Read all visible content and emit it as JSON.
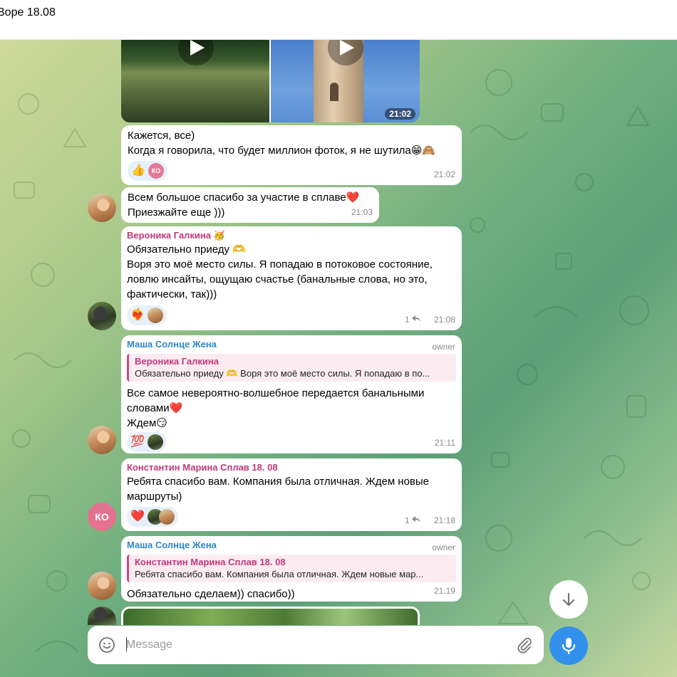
{
  "header": {
    "title": "Воре 18.08"
  },
  "media_album": {
    "time": "21:02"
  },
  "messages": [
    {
      "lines": [
        "Кажется, все)",
        "Когда я говорила, что будет миллион фоток, я не шутила😁🙈"
      ],
      "reactions": [
        "👍",
        "КО"
      ],
      "time": "21:02"
    },
    {
      "lines": [
        "Всем большое спасибо за участие в сплаве❤️",
        "Приезжайте еще )))"
      ],
      "time": "21:03"
    },
    {
      "sender": "Вероника Галкина 🥳",
      "lines": [
        "Обязательно приеду 🫶",
        "Воря это моё место силы. Я попадаю в потоковое состояние,",
        "ловлю инсайты, ощущаю счастье (банальные слова, но это,",
        "фактически, так)))"
      ],
      "reactions": [
        "❤️‍🔥"
      ],
      "reply_count": "1",
      "time": "21:08"
    },
    {
      "sender": "Маша Солнце Жена",
      "badge": "owner",
      "quote": {
        "name": "Вероника Галкина",
        "text": "Обязательно приеду 🫶 Воря это моё место силы. Я попадаю в по..."
      },
      "lines": [
        "Все самое невероятно-волшебное передается банальными",
        "словами❤️",
        "Ждем😏"
      ],
      "reactions": [
        "💯"
      ],
      "time": "21:11"
    },
    {
      "sender": "Константин Марина Сплав 18. 08",
      "lines": [
        "Ребята спасибо вам. Компания была отличная. Ждем новые",
        "маршруты)"
      ],
      "reactions": [
        "❤️"
      ],
      "reply_count": "1",
      "time": "21:18"
    },
    {
      "sender": "Маша Солнце Жена",
      "badge": "owner",
      "quote": {
        "name": "Константин Марина Сплав 18. 08",
        "text": "Ребята спасибо вам. Компания была отличная. Ждем новые мар..."
      },
      "lines": [
        "Обязательно сделаем)) спасибо))"
      ],
      "time": "21:19"
    }
  ],
  "avatars": {
    "ko_initials": "КО"
  },
  "composer": {
    "placeholder": "Message"
  },
  "icons": {
    "emoji": "smile-icon",
    "attach": "paperclip-icon",
    "mic": "microphone-icon",
    "scroll_down": "arrow-down-icon",
    "play": "play-icon"
  },
  "colors": {
    "accent": "#3390ec",
    "sender_pink": "#c1387a",
    "sender_blue": "#2f86c6",
    "reaction_bg": "#e6f0fb"
  }
}
